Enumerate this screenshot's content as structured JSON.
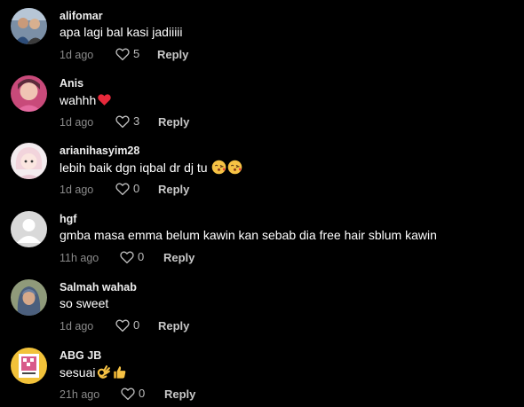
{
  "comments": [
    {
      "username": "alifomar",
      "text": "apa lagi bal kasi jadiiiii",
      "time": "1d ago",
      "likes": "5",
      "reply": "Reply"
    },
    {
      "username": "Anis",
      "text": "wahhh",
      "time": "1d ago",
      "likes": "3",
      "reply": "Reply"
    },
    {
      "username": "arianihasyim28",
      "text": "lebih baik dgn iqbal dr dj tu",
      "time": "1d ago",
      "likes": "0",
      "reply": "Reply"
    },
    {
      "username": "hgf",
      "text": "gmba masa emma belum kawin kan sebab dia free hair sblum kawin",
      "time": "11h ago",
      "likes": "0",
      "reply": "Reply"
    },
    {
      "username": "Salmah wahab",
      "text": "so sweet",
      "time": "1d ago",
      "likes": "0",
      "reply": "Reply"
    },
    {
      "username": "ABG JB",
      "text": "sesuai",
      "time": "21h ago",
      "likes": "0",
      "reply": "Reply"
    }
  ],
  "icons": {
    "like": "heart-outline-icon",
    "emoji_heart": "red-heart-emoji",
    "emoji_kiss": "kissing-face-emoji",
    "emoji_ok": "ok-hand-emoji",
    "emoji_thumbs": "thumbs-up-emoji"
  },
  "colors": {
    "background": "#000000",
    "meta": "#8a8a8a",
    "heart": "#e8293b"
  }
}
